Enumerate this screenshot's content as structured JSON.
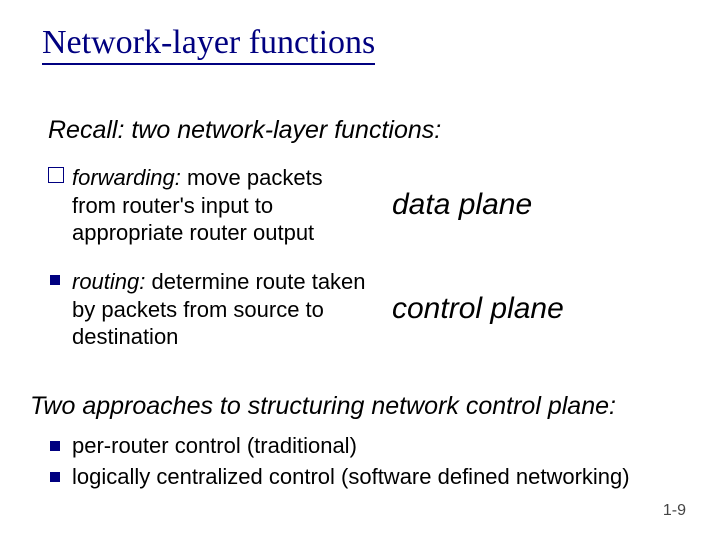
{
  "title": "Network-layer functions",
  "recall": "Recall: two network-layer functions:",
  "items": [
    {
      "term": "forwarding:",
      "desc": " move packets from router's input to appropriate router output",
      "label": "data plane"
    },
    {
      "term": "routing:",
      "desc": " determine route taken by packets from source to destination",
      "label": "control plane"
    }
  ],
  "approaches_heading": "Two approaches to structuring network control plane:",
  "approaches": [
    "per-router control (traditional)",
    "logically centralized control (software defined networking)"
  ],
  "pagenum": "1-9"
}
